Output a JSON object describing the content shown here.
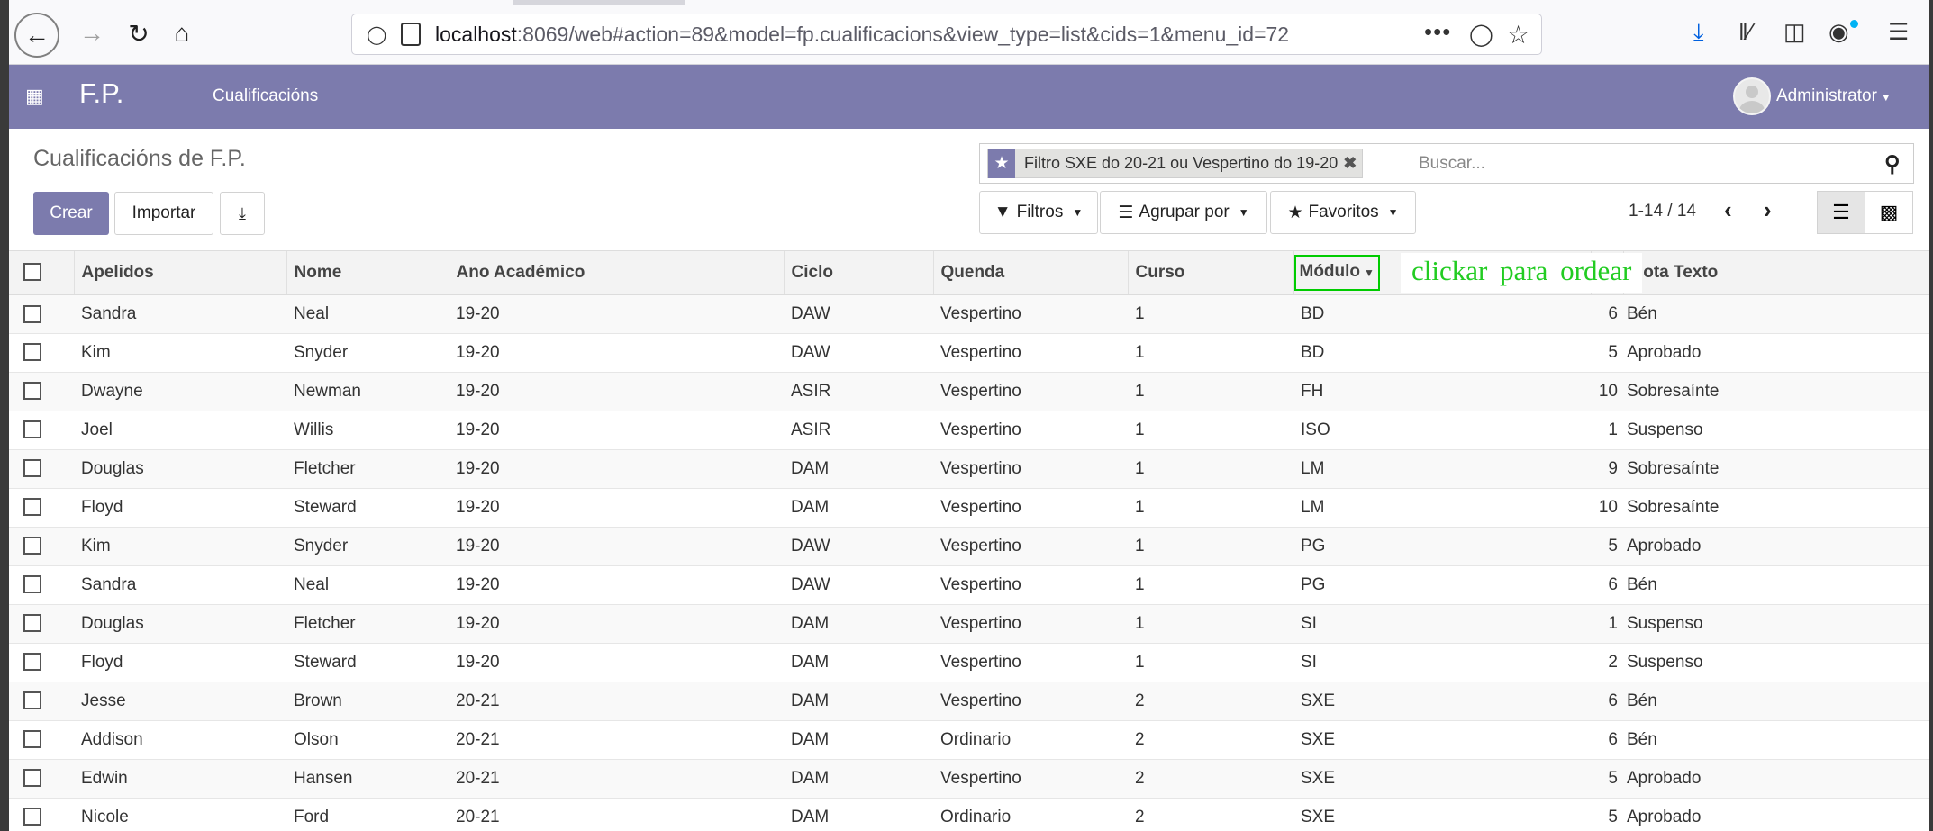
{
  "browser": {
    "url_host": "localhost",
    "url_rest": ":8069/web#action=89&model=fp.cualificacions&view_type=list&cids=1&menu_id=72"
  },
  "navbar": {
    "brand": "F.P.",
    "menu_item": "Cualificacións",
    "user": "Administrator",
    "color": "#7c7bad"
  },
  "control_panel": {
    "title": "Cualificacións de F.P.",
    "create_label": "Crear",
    "import_label": "Importar",
    "facet_label": "Filtro SXE do 20-21 ou Vespertino do 19-20",
    "search_placeholder": "Buscar...",
    "filters_label": "Filtros",
    "groupby_label": "Agrupar por",
    "favorites_label": "Favoritos",
    "pager": "1-14 / 14"
  },
  "annotation": "clickar para ordear",
  "table": {
    "headers": [
      "Apelidos",
      "Nome",
      "Ano Académico",
      "Ciclo",
      "Quenda",
      "Curso",
      "Módulo",
      "ta",
      "Nota Texto"
    ],
    "rows": [
      [
        "Sandra",
        "Neal",
        "19-20",
        "DAW",
        "Vespertino",
        "1",
        "BD",
        "6",
        "Bén"
      ],
      [
        "Kim",
        "Snyder",
        "19-20",
        "DAW",
        "Vespertino",
        "1",
        "BD",
        "5",
        "Aprobado"
      ],
      [
        "Dwayne",
        "Newman",
        "19-20",
        "ASIR",
        "Vespertino",
        "1",
        "FH",
        "10",
        "Sobresaínte"
      ],
      [
        "Joel",
        "Willis",
        "19-20",
        "ASIR",
        "Vespertino",
        "1",
        "ISO",
        "1",
        "Suspenso"
      ],
      [
        "Douglas",
        "Fletcher",
        "19-20",
        "DAM",
        "Vespertino",
        "1",
        "LM",
        "9",
        "Sobresaínte"
      ],
      [
        "Floyd",
        "Steward",
        "19-20",
        "DAM",
        "Vespertino",
        "1",
        "LM",
        "10",
        "Sobresaínte"
      ],
      [
        "Kim",
        "Snyder",
        "19-20",
        "DAW",
        "Vespertino",
        "1",
        "PG",
        "5",
        "Aprobado"
      ],
      [
        "Sandra",
        "Neal",
        "19-20",
        "DAW",
        "Vespertino",
        "1",
        "PG",
        "6",
        "Bén"
      ],
      [
        "Douglas",
        "Fletcher",
        "19-20",
        "DAM",
        "Vespertino",
        "1",
        "SI",
        "1",
        "Suspenso"
      ],
      [
        "Floyd",
        "Steward",
        "19-20",
        "DAM",
        "Vespertino",
        "1",
        "SI",
        "2",
        "Suspenso"
      ],
      [
        "Jesse",
        "Brown",
        "20-21",
        "DAM",
        "Vespertino",
        "2",
        "SXE",
        "6",
        "Bén"
      ],
      [
        "Addison",
        "Olson",
        "20-21",
        "DAM",
        "Ordinario",
        "2",
        "SXE",
        "6",
        "Bén"
      ],
      [
        "Edwin",
        "Hansen",
        "20-21",
        "DAM",
        "Vespertino",
        "2",
        "SXE",
        "5",
        "Aprobado"
      ],
      [
        "Nicole",
        "Ford",
        "20-21",
        "DAM",
        "Ordinario",
        "2",
        "SXE",
        "5",
        "Aprobado"
      ]
    ]
  }
}
